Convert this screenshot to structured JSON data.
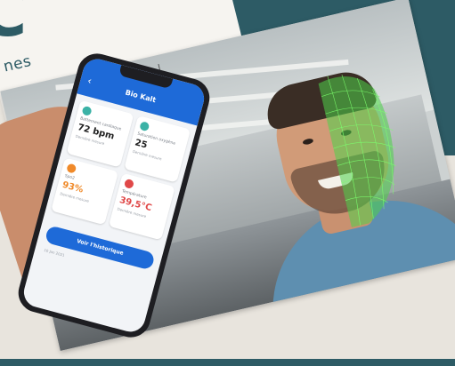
{
  "page": {
    "headline_fragment": "C",
    "text_fragment": "nes"
  },
  "phone_app": {
    "title": "Bio Kalt",
    "back_icon": "chevron-left-icon",
    "cards": [
      {
        "label": "Battement cardiaque",
        "value": "72 bpm",
        "sub": "Dernière mesure",
        "icon": "heart-icon",
        "color": "#3bb2a6",
        "value_color": "#222222"
      },
      {
        "label": "Saturation oxygène",
        "value": "25",
        "sub": "Dernière mesure",
        "icon": "drop-icon",
        "color": "#3bb2a6",
        "value_color": "#222222"
      },
      {
        "label": "Spo2",
        "value": "93%",
        "sub": "Dernière mesure",
        "icon": "lungs-icon",
        "color": "#f08a2a",
        "value_color": "#f08a2a"
      },
      {
        "label": "Température",
        "value": "39,5°C",
        "sub": "Dernière mesure",
        "icon": "thermometer-icon",
        "color": "#e04848",
        "value_color": "#e04848"
      }
    ],
    "cta_label": "Voir l'historique",
    "footnote": "10 Jan 2021"
  },
  "colors": {
    "teal": "#2d5b65",
    "app_blue": "#1e6ad8",
    "face_mesh": "#4fd14a"
  }
}
